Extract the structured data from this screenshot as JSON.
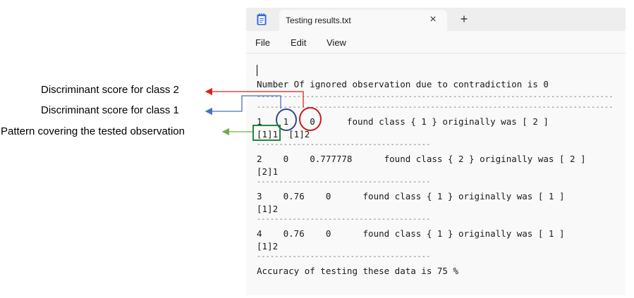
{
  "window": {
    "tab_title": "Testing results.txt",
    "tab_close_glyph": "×",
    "new_tab_glyph": "+"
  },
  "menu": [
    "File",
    "Edit",
    "View"
  ],
  "content": {
    "header": "Number Of ignored observation due to contradiction is 0",
    "separator_long": "--------------------------------------------------------------------------------",
    "separator_short": "---------------------------------------",
    "records": [
      {
        "line": "1    1    0      found class { 1 } originally was [ 2 ]",
        "pattern": "[1]1  [1]2"
      },
      {
        "line": "2    0    0.777778      found class { 2 } originally was [ 2 ]",
        "pattern": "[2]1"
      },
      {
        "line": "3    0.76    0      found class { 1 } originally was [ 1 ]",
        "pattern": "[1]2"
      },
      {
        "line": "4    0.76    0      found class { 1 } originally was [ 1 ]",
        "pattern": "[1]2"
      }
    ],
    "footer": "Accuracy of testing these data is 75 %"
  },
  "annotations": [
    {
      "text": "Discriminant score for class 2",
      "color": "#e02020"
    },
    {
      "text": "Discriminant score for class 1",
      "color": "#4472c4"
    },
    {
      "text": "Pattern covering the tested observation",
      "color": "#70ad47"
    }
  ],
  "colors": {
    "notepad_icon": "#2f6bd8",
    "circle_class1": "#2f4a8a",
    "circle_class2": "#d01a1a",
    "box_pattern": "#1f8a3a"
  }
}
